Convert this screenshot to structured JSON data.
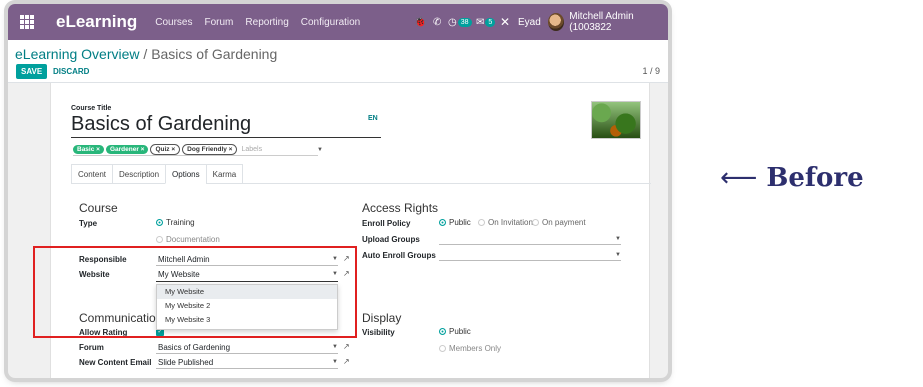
{
  "topbar": {
    "brand": "eLearning",
    "menu": [
      "Courses",
      "Forum",
      "Reporting",
      "Configuration"
    ],
    "badge_activity": "38",
    "badge_messages": "5",
    "user_short": "Eyad",
    "user_full": "Mitchell Admin (1003822"
  },
  "breadcrumb": {
    "parent": "eLearning Overview",
    "separator": " / ",
    "current": "Basics of Gardening"
  },
  "actions": {
    "save": "SAVE",
    "discard": "DISCARD"
  },
  "pager": "1 / 9",
  "form": {
    "title_label": "Course Title",
    "title": "Basics of Gardening",
    "lang": "EN",
    "tags": [
      {
        "label": "Basic ×",
        "style": "g"
      },
      {
        "label": "Gardener ×",
        "style": "g"
      },
      {
        "label": "Quiz ×",
        "style": "o"
      },
      {
        "label": "Dog Friendly ×",
        "style": "o"
      }
    ],
    "tags_placeholder": "Labels",
    "tabs": [
      "Content",
      "Description",
      "Options",
      "Karma"
    ],
    "active_tab": "Options",
    "course": {
      "heading": "Course",
      "type_label": "Type",
      "type_options": [
        "Training",
        "Documentation"
      ],
      "type_selected": "Training",
      "responsible_label": "Responsible",
      "responsible": "Mitchell Admin",
      "website_label": "Website",
      "website": "My Website",
      "website_options": [
        "My Website",
        "My Website 2",
        "My Website 3"
      ]
    },
    "access": {
      "heading": "Access Rights",
      "enroll_label": "Enroll Policy",
      "enroll_options": [
        "Public",
        "On Invitation",
        "On payment"
      ],
      "enroll_selected": "Public",
      "upload_label": "Upload Groups",
      "auto_enroll_label": "Auto Enroll Groups"
    },
    "communication": {
      "heading": "Communication",
      "rating_label": "Allow Rating",
      "forum_label": "Forum",
      "forum": "Basics of Gardening",
      "email_label": "New Content Email",
      "email": "Slide Published"
    },
    "display": {
      "heading": "Display",
      "visibility_label": "Visibility",
      "visibility_options": [
        "Public",
        "Members Only"
      ],
      "visibility_selected": "Public"
    }
  },
  "annotation": {
    "arrow": "⟵",
    "text": "Before"
  }
}
